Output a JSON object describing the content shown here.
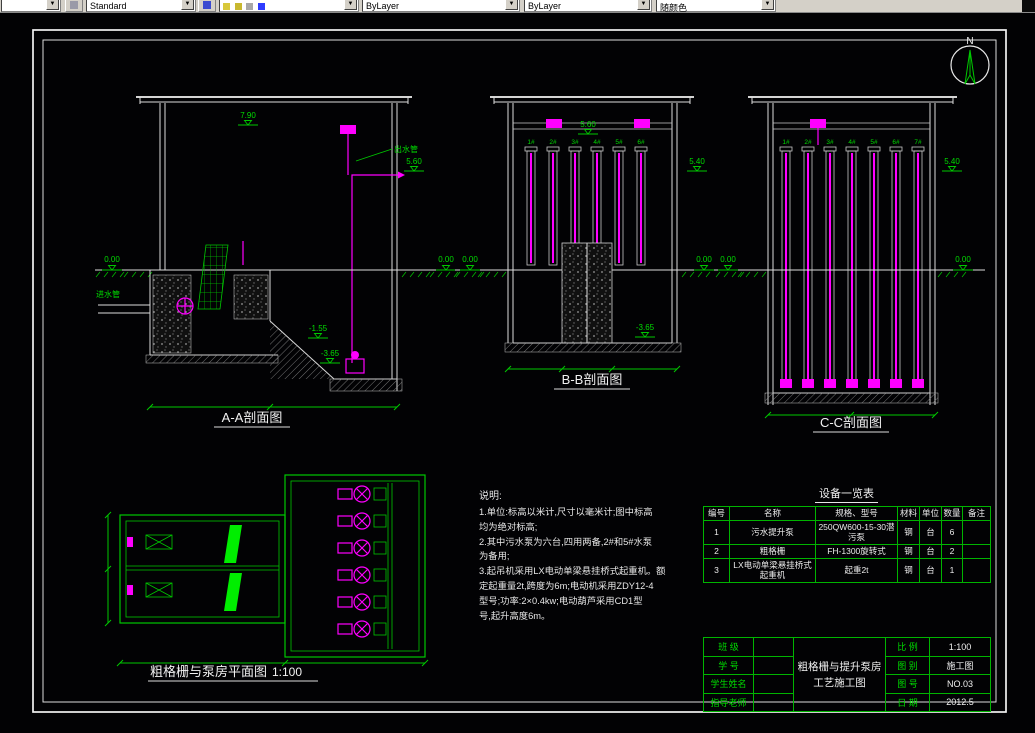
{
  "toolbar": {
    "style_value": "Standard",
    "color_value": "ByLayer",
    "linetype_value": "ByLayer",
    "lineweight_value": "随颜色"
  },
  "drawing": {
    "north_label": "N",
    "sections": {
      "aa": {
        "label": "A-A剖面图"
      },
      "bb": {
        "label": "B-B剖面图"
      },
      "cc": {
        "label": "C-C剖面图"
      }
    },
    "plan": {
      "label": "粗格栅与泵房平面图",
      "scale": "1:100"
    },
    "elevations": {
      "aa_top": "7.90",
      "pipe_out": "5.60",
      "bb_beam": "5.60",
      "bb_right": "5.40",
      "cc_right": "5.40",
      "ground": "0.00",
      "m155": "-1.55",
      "m365": "-3.65"
    },
    "labels": {
      "inlet_pipe": "进水管",
      "outlet_pipe": "出水管"
    },
    "bb_tubes": [
      "1#",
      "2#",
      "3#",
      "4#",
      "5#",
      "6#"
    ],
    "cc_tubes": [
      "1#",
      "2#",
      "3#",
      "4#",
      "5#",
      "6#",
      "7#"
    ]
  },
  "notes": {
    "title": "说明:",
    "lines": [
      "1.单位:标高以米计,尺寸以毫米计;图中标高",
      "均为绝对标高;",
      "2.其中污水泵为六台,四用两备,2#和5#水泵",
      "为备用;",
      "3.起吊机采用LX电动单梁悬挂桥式起重机。额",
      "定起重量2t,跨度为6m;电动机采用ZDY12-4",
      "型号;功率:2×0.4kw;电动葫芦采用CD1型",
      "号,起升高度6m。"
    ]
  },
  "equipment_table": {
    "title": "设备一览表",
    "headers": [
      "编号",
      "名称",
      "规格、型号",
      "材料",
      "单位",
      "数量",
      "备注"
    ],
    "rows": [
      [
        "1",
        "污水提升泵",
        "250QW600-15-30潜污泵",
        "钢",
        "台",
        "6",
        ""
      ],
      [
        "2",
        "粗格栅",
        "FH-1300旋转式",
        "钢",
        "台",
        "2",
        ""
      ],
      [
        "3",
        "LX电动单梁悬挂桥式起重机",
        "起重2t",
        "钢",
        "台",
        "1",
        ""
      ]
    ]
  },
  "title_block": {
    "left_labels": [
      "班 级",
      "学 号",
      "学生姓名",
      "指导老师"
    ],
    "title_line1": "粗格栅与提升泵房",
    "title_line2": "工艺施工图",
    "info_labels": [
      "比 例",
      "图 别",
      "图 号",
      "日 期"
    ],
    "info_values": [
      "1:100",
      "施工图",
      "NO.03",
      "2012.5"
    ]
  }
}
